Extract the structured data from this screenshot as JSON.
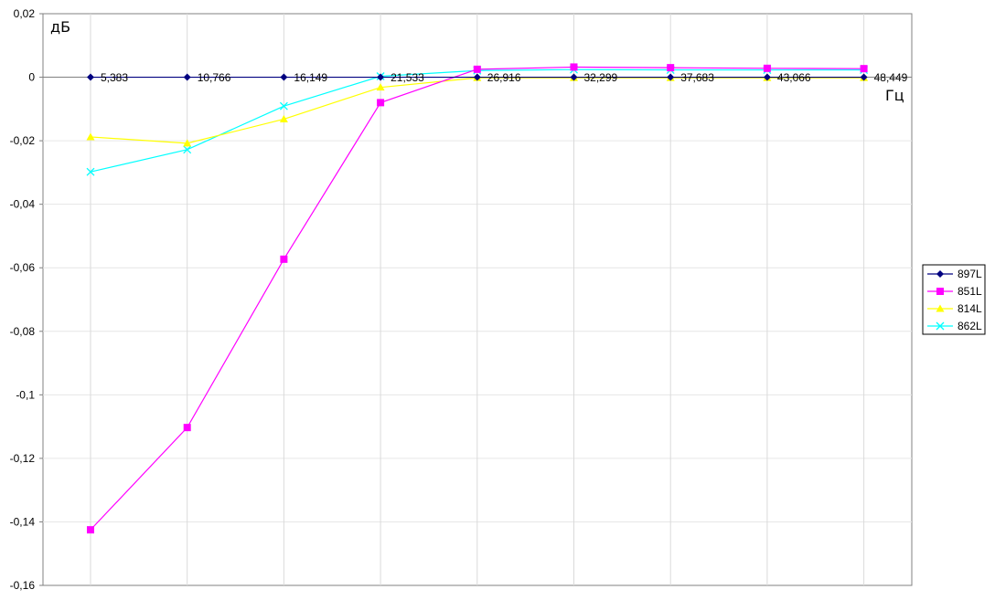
{
  "chart_data": {
    "type": "line",
    "ylabel": "дБ",
    "xlabel": "Гц",
    "ylim": [
      -0.16,
      0.02
    ],
    "ytick_step": 0.02,
    "ytick_labels": [
      "0,02",
      "0",
      "-0,02",
      "-0,04",
      "-0,06",
      "-0,08",
      "-0,1",
      "-0,12",
      "-0,14",
      "-0,16"
    ],
    "categories": [
      "5,383",
      "10,766",
      "16,149",
      "21,533",
      "26,916",
      "32,299",
      "37,683",
      "43,066",
      "48,449"
    ],
    "grid": true,
    "legend_position": "right",
    "series": [
      {
        "name": "897L",
        "color": "#000080",
        "marker": "diamond",
        "values": [
          0,
          0,
          0,
          0,
          0,
          0,
          0,
          0,
          0
        ]
      },
      {
        "name": "851L",
        "color": "#ff00ff",
        "marker": "square",
        "values": [
          -0.1425,
          -0.1103,
          -0.0573,
          -0.008,
          0.0025,
          0.0032,
          0.003,
          0.0028,
          0.0027
        ]
      },
      {
        "name": "814L",
        "color": "#ffff00",
        "marker": "triangle",
        "values": [
          -0.0188,
          -0.0208,
          -0.0132,
          -0.0032,
          -0.0002,
          -0.0002,
          -0.0002,
          -0.0002,
          -0.0002
        ]
      },
      {
        "name": "862L",
        "color": "#00ffff",
        "marker": "x",
        "values": [
          -0.0298,
          -0.0228,
          -0.0091,
          0.0003,
          0.0021,
          0.0024,
          0.0023,
          0.0023,
          0.0023
        ]
      }
    ]
  }
}
